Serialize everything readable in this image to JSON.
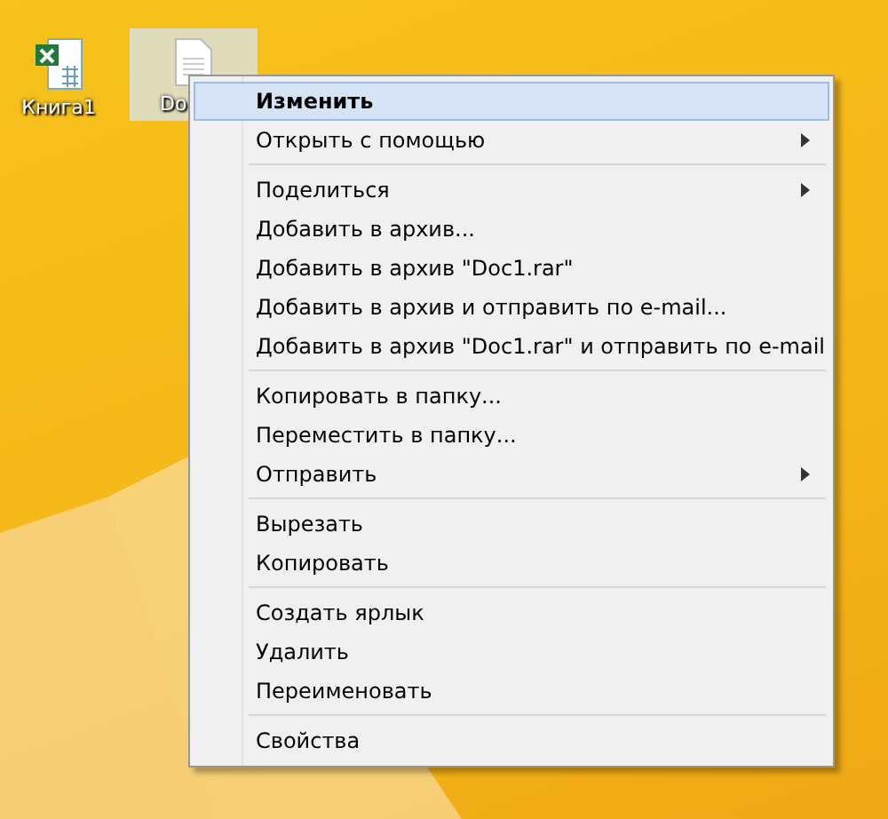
{
  "desktop_icons": [
    {
      "kind": "spreadsheet",
      "label": "Книга1",
      "selected": false
    },
    {
      "kind": "document",
      "label": "Do",
      "selected": true
    }
  ],
  "context_menu": {
    "sections": [
      [
        {
          "label": "Изменить",
          "default": true,
          "selected": true,
          "submenu": false
        },
        {
          "label": "Открыть с помощью",
          "default": false,
          "selected": false,
          "submenu": true
        }
      ],
      [
        {
          "label": "Поделиться",
          "default": false,
          "selected": false,
          "submenu": true
        },
        {
          "label": "Добавить в архив...",
          "default": false,
          "selected": false,
          "submenu": false
        },
        {
          "label": "Добавить в архив \"Doc1.rar\"",
          "default": false,
          "selected": false,
          "submenu": false
        },
        {
          "label": "Добавить в архив и отправить по e-mail...",
          "default": false,
          "selected": false,
          "submenu": false
        },
        {
          "label": "Добавить в архив \"Doc1.rar\" и отправить по e-mail",
          "default": false,
          "selected": false,
          "submenu": false
        }
      ],
      [
        {
          "label": "Копировать в папку...",
          "default": false,
          "selected": false,
          "submenu": false
        },
        {
          "label": "Переместить в папку...",
          "default": false,
          "selected": false,
          "submenu": false
        },
        {
          "label": "Отправить",
          "default": false,
          "selected": false,
          "submenu": true
        }
      ],
      [
        {
          "label": "Вырезать",
          "default": false,
          "selected": false,
          "submenu": false
        },
        {
          "label": "Копировать",
          "default": false,
          "selected": false,
          "submenu": false
        }
      ],
      [
        {
          "label": "Создать ярлык",
          "default": false,
          "selected": false,
          "submenu": false
        },
        {
          "label": "Удалить",
          "default": false,
          "selected": false,
          "submenu": false
        },
        {
          "label": "Переименовать",
          "default": false,
          "selected": false,
          "submenu": false
        }
      ],
      [
        {
          "label": "Свойства",
          "default": false,
          "selected": false,
          "submenu": false
        }
      ]
    ]
  }
}
